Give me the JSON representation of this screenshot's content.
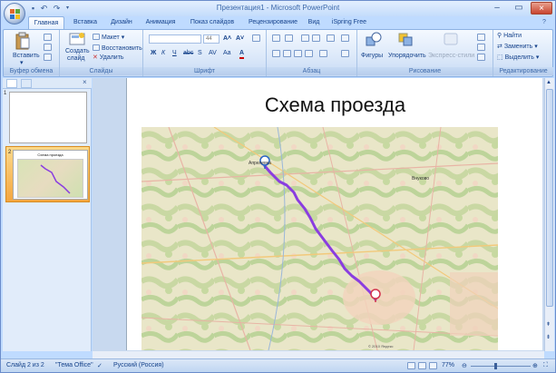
{
  "window": {
    "title": "Презентация1 - Microsoft PowerPoint"
  },
  "tabs": [
    {
      "label": "Главная",
      "active": true
    },
    {
      "label": "Вставка"
    },
    {
      "label": "Дизайн"
    },
    {
      "label": "Анимация"
    },
    {
      "label": "Показ слайдов"
    },
    {
      "label": "Рецензирование"
    },
    {
      "label": "Вид"
    },
    {
      "label": "iSpring Free"
    }
  ],
  "ribbon": {
    "clipboard": {
      "paste": "Вставить",
      "group": "Буфер обмена"
    },
    "slides": {
      "new_slide_1": "Создать",
      "new_slide_2": "слайд",
      "layout": "Макет",
      "reset": "Восстановить",
      "delete": "Удалить",
      "group": "Слайды"
    },
    "font": {
      "font_name": "",
      "font_size": "44",
      "group": "Шрифт"
    },
    "paragraph": {
      "group": "Абзац"
    },
    "drawing": {
      "shapes": "Фигуры",
      "arrange": "Упорядочить",
      "quick_styles": "Экспресс-стили",
      "group": "Рисование"
    },
    "editing": {
      "find": "Найти",
      "replace": "Заменить",
      "select": "Выделить",
      "group": "Редактирование"
    }
  },
  "thumbnails": [
    {
      "number": "1",
      "title": ""
    },
    {
      "number": "2",
      "title": "Схема проезда"
    }
  ],
  "slide": {
    "title": "Схема проезда"
  },
  "map": {
    "place_top": "Апрелевка",
    "place_right": "Внуково",
    "copyright": "© 2010 Яндекс"
  },
  "status": {
    "slide": "Слайд 2 из 2",
    "theme": "\"Тема Office\"",
    "language": "Русский (Россия)",
    "zoom": "77%"
  },
  "colors": {
    "accent": "#15428b",
    "route": "#8a3de0"
  }
}
